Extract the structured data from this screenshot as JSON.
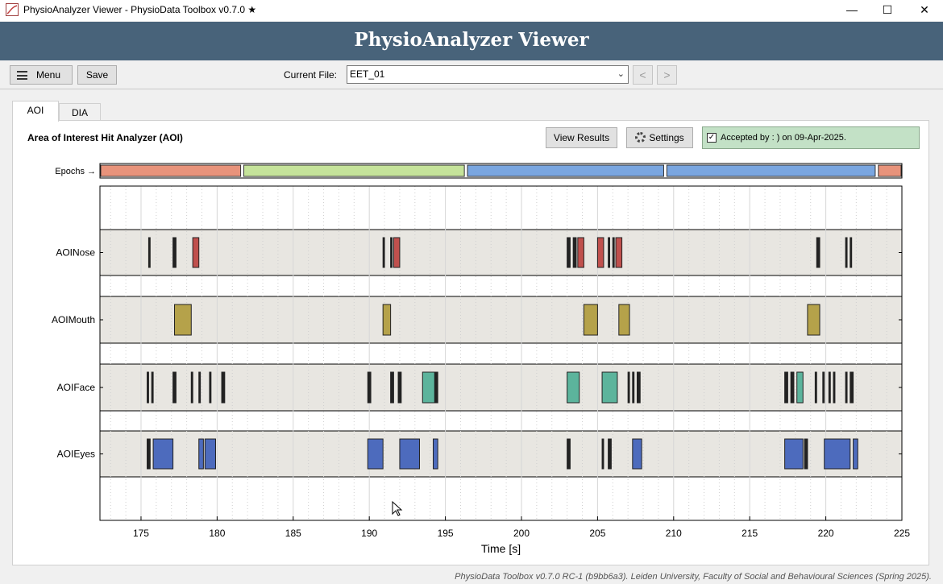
{
  "window": {
    "title": "PhysioAnalyzer Viewer - PhysioData Toolbox v0.7.0 ★",
    "minimize_glyph": "—",
    "maximize_glyph": "☐",
    "close_glyph": "✕"
  },
  "header": {
    "title": "PhysioAnalyzer Viewer"
  },
  "toolbar": {
    "menu_label": "Menu",
    "save_label": "Save",
    "current_file_label": "Current File:",
    "current_file_value": "EET_01",
    "prev_glyph": "<",
    "next_glyph": ">"
  },
  "tabs": [
    {
      "label": "AOI",
      "active": true
    },
    {
      "label": "DIA",
      "active": false
    }
  ],
  "panel": {
    "title": "Area of Interest Hit Analyzer (AOI)",
    "view_results_label": "View Results",
    "settings_label": "Settings",
    "accepted_text": "Accepted by : ) on 09-Apr-2025.",
    "accepted_checked": true
  },
  "colors": {
    "header_bg": "#48637a",
    "accepted_bg": "#c3e1c6",
    "row_bg": "#e8e6e1"
  },
  "footer": {
    "text": "PhysioData Toolbox v0.7.0 RC-1 (b9bb6a3). Leiden University, Faculty of Social and Behavioural Sciences (Spring 2025)."
  },
  "chart_data": {
    "type": "timeline",
    "xlabel": "Time [s]",
    "xlim": [
      172.3,
      225
    ],
    "xticks": [
      175,
      180,
      185,
      190,
      195,
      200,
      205,
      210,
      215,
      220,
      225
    ],
    "epochs_label": "Epochs →",
    "epochs": [
      {
        "start": 172.3,
        "end": 181.6,
        "color": "#e8937b"
      },
      {
        "start": 181.7,
        "end": 196.3,
        "color": "#c5e39a"
      },
      {
        "start": 196.4,
        "end": 209.4,
        "color": "#7aa6e0"
      },
      {
        "start": 209.5,
        "end": 223.3,
        "color": "#7aa6e0"
      },
      {
        "start": 223.4,
        "end": 225,
        "color": "#e8937b"
      }
    ],
    "rows": [
      {
        "name": "AOINose",
        "color": "#c0504d",
        "hits": [
          [
            175.5,
            175.6
          ],
          [
            177.1,
            177.3
          ],
          [
            178.4,
            178.8
          ],
          [
            190.9,
            191.0
          ],
          [
            191.4,
            191.5
          ],
          [
            191.6,
            192.0
          ],
          [
            203.0,
            203.2
          ],
          [
            203.4,
            203.6
          ],
          [
            203.7,
            204.1
          ],
          [
            205.0,
            205.4
          ],
          [
            205.7,
            205.8
          ],
          [
            206.0,
            206.1
          ],
          [
            206.2,
            206.6
          ],
          [
            219.4,
            219.6
          ],
          [
            221.3,
            221.4
          ],
          [
            221.6,
            221.7
          ]
        ]
      },
      {
        "name": "AOIMouth",
        "color": "#b5a24a",
        "hits": [
          [
            177.2,
            178.3
          ],
          [
            190.9,
            191.4
          ],
          [
            204.1,
            205.0
          ],
          [
            206.4,
            207.1
          ],
          [
            218.8,
            219.6
          ]
        ]
      },
      {
        "name": "AOIFace",
        "color": "#5cb49c",
        "hits": [
          [
            175.4,
            175.5
          ],
          [
            175.7,
            175.8
          ],
          [
            177.1,
            177.3
          ],
          [
            178.3,
            178.4
          ],
          [
            178.8,
            178.9
          ],
          [
            179.5,
            179.6
          ],
          [
            180.3,
            180.5
          ],
          [
            189.9,
            190.1
          ],
          [
            191.4,
            191.6
          ],
          [
            191.9,
            192.1
          ],
          [
            193.5,
            194.3
          ],
          [
            194.3,
            194.5
          ],
          [
            203.0,
            203.8
          ],
          [
            205.3,
            206.3
          ],
          [
            207.0,
            207.1
          ],
          [
            207.3,
            207.4
          ],
          [
            207.6,
            207.8
          ],
          [
            217.3,
            217.5
          ],
          [
            217.7,
            217.9
          ],
          [
            218.1,
            218.5
          ],
          [
            219.3,
            219.4
          ],
          [
            219.8,
            219.9
          ],
          [
            220.2,
            220.3
          ],
          [
            220.5,
            220.6
          ],
          [
            221.3,
            221.4
          ],
          [
            221.6,
            221.8
          ]
        ]
      },
      {
        "name": "AOIEyes",
        "color": "#4d6bbd",
        "hits": [
          [
            175.4,
            175.6
          ],
          [
            175.8,
            177.1
          ],
          [
            178.8,
            179.1
          ],
          [
            179.2,
            179.9
          ],
          [
            189.9,
            190.9
          ],
          [
            192.0,
            193.3
          ],
          [
            194.2,
            194.5
          ],
          [
            203.0,
            203.2
          ],
          [
            205.3,
            205.4
          ],
          [
            205.7,
            205.9
          ],
          [
            207.3,
            207.9
          ],
          [
            217.3,
            218.5
          ],
          [
            218.6,
            218.8
          ],
          [
            219.9,
            221.6
          ],
          [
            221.8,
            222.1
          ]
        ]
      }
    ]
  }
}
